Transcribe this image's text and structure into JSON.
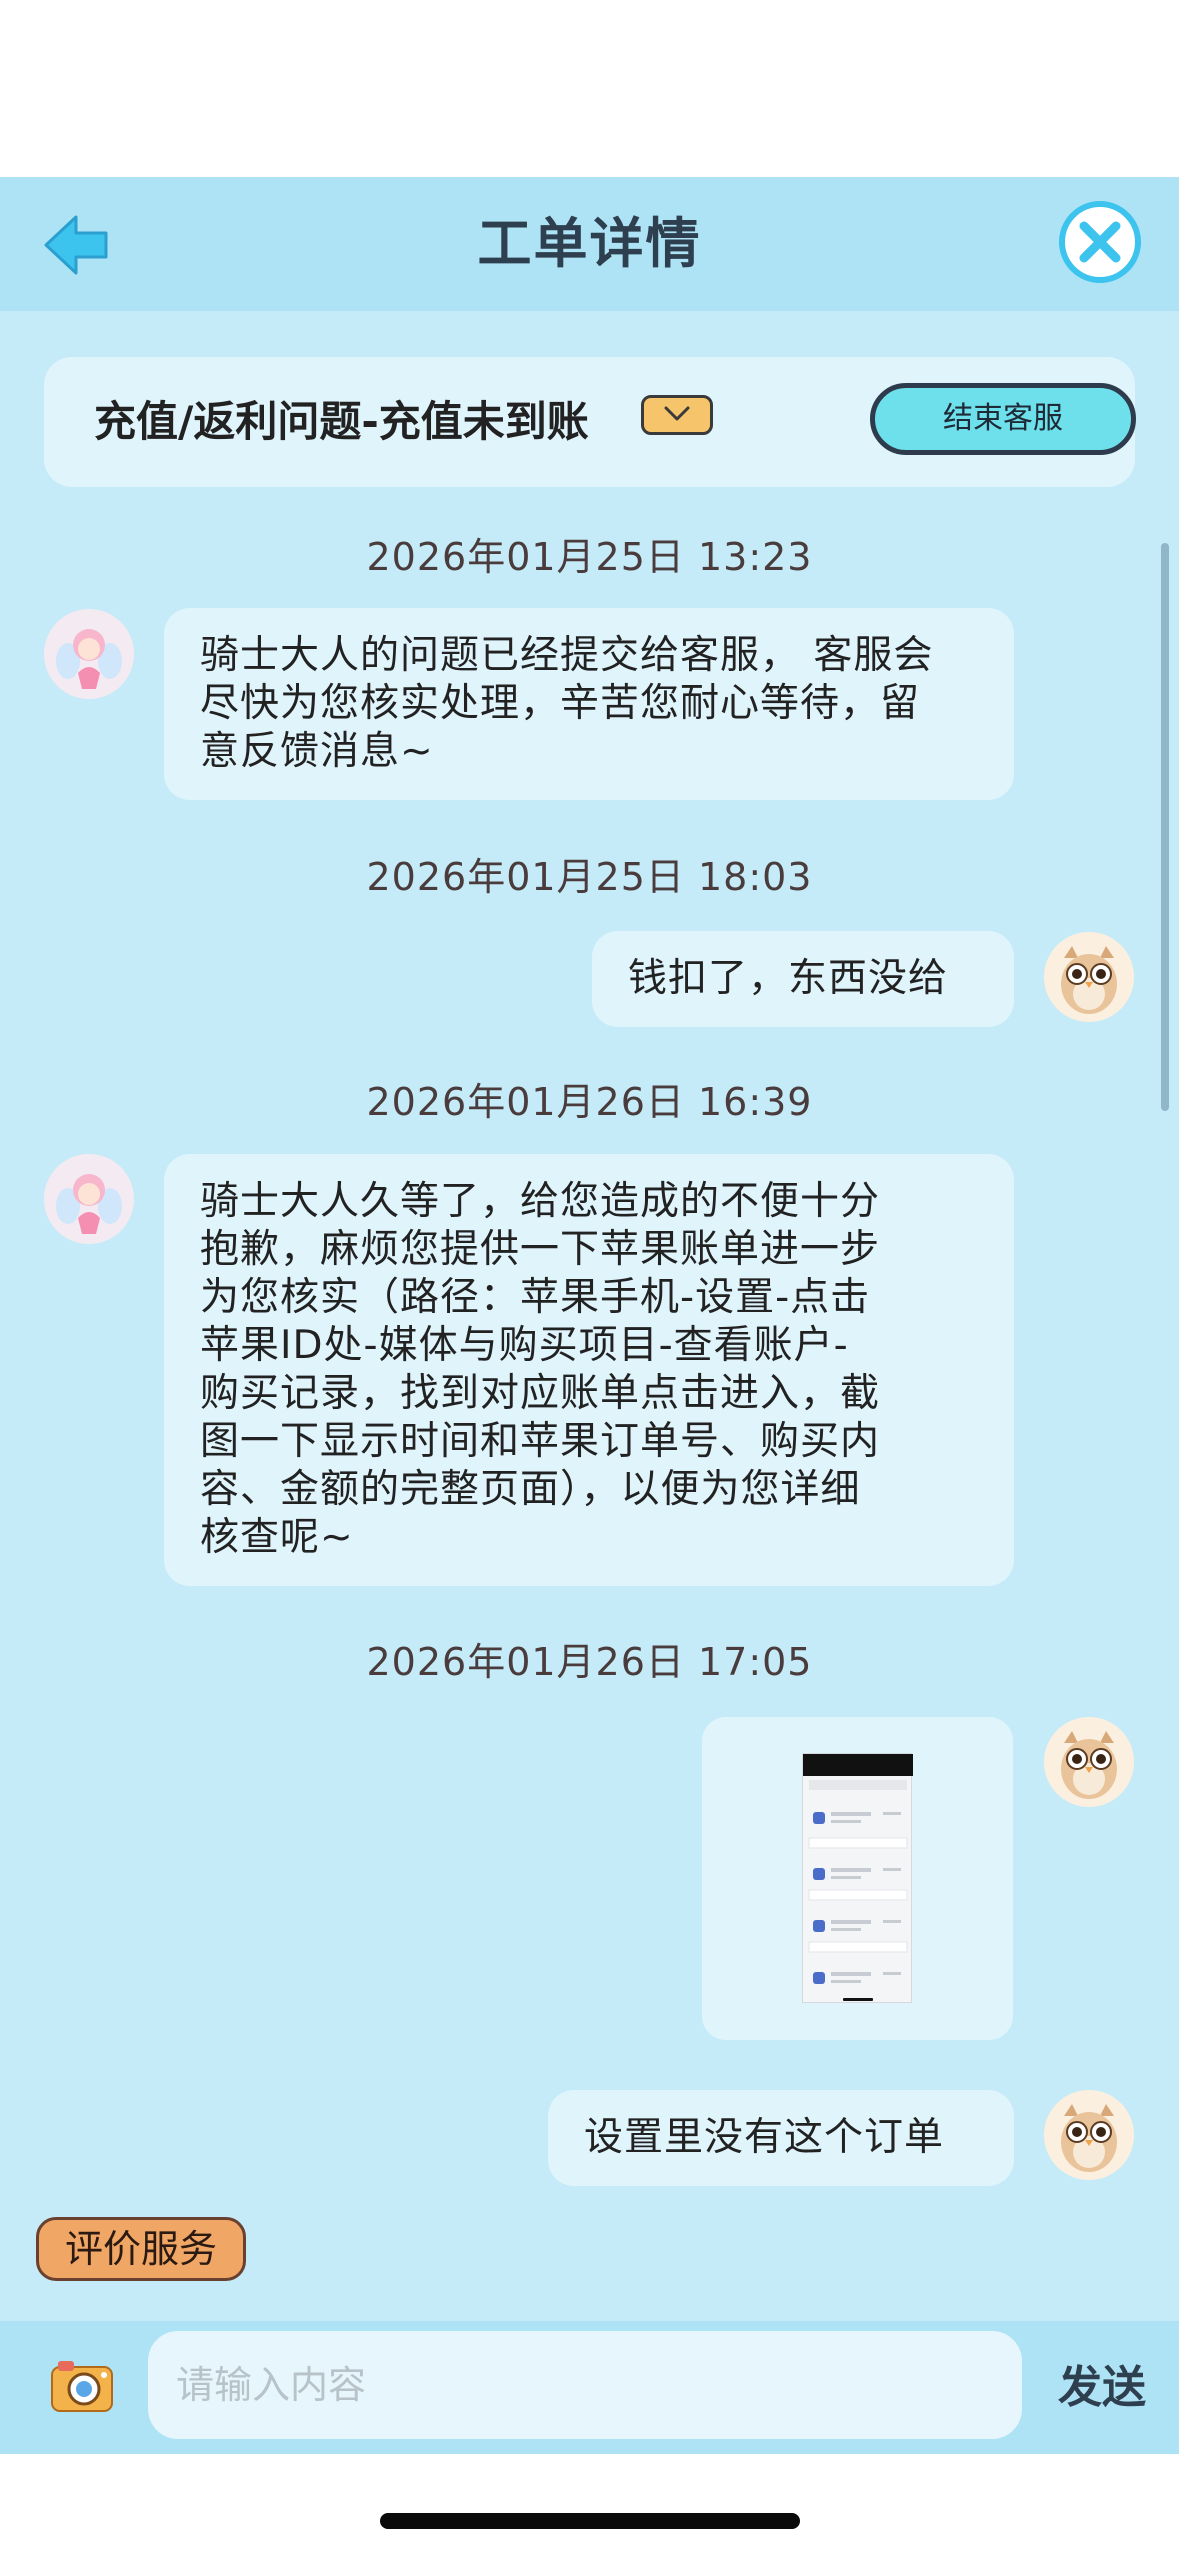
{
  "header": {
    "title": "工单详情",
    "back_icon": "back-arrow-icon",
    "close_icon": "close-circle-icon"
  },
  "topic": {
    "text": "充值/返利问题-充值未到账",
    "end_button": "结束客服"
  },
  "messages": [
    {
      "time": "2026年01月25日 13:23",
      "sender": "agent",
      "text": "骑士大人的问题已经提交给客服， 客服会\n尽快为您核实处理，辛苦您耐心等待，留\n意反馈消息~"
    },
    {
      "time": "2026年01月25日 18:03",
      "sender": "user",
      "text": "钱扣了，东西没给"
    },
    {
      "time": "2026年01月26日 16:39",
      "sender": "agent",
      "text": "骑士大人久等了，给您造成的不便十分\n抱歉，麻烦您提供一下苹果账单进一步\n为您核实（路径：苹果手机-设置-点击\n苹果ID处-媒体与购买项目-查看账户-\n购买记录，找到对应账单点击进入，截\n图一下显示时间和苹果订单号、购买内\n容、金额的完整页面），以便为您详细\n核查呢~"
    },
    {
      "time": "2026年01月26日 17:05",
      "sender": "user",
      "type": "image"
    },
    {
      "sender": "user",
      "text": "设置里没有这个订单"
    }
  ],
  "rate_button": "评价服务",
  "input": {
    "placeholder": "请输入内容",
    "send_label": "发送"
  },
  "colors": {
    "header_bg": "#aee3f5",
    "chat_bg": "#c6ebf8",
    "bubble_bg": "#e0f4fc",
    "accent_cyan": "#6de0ec",
    "rate_orange": "#f0a665"
  }
}
